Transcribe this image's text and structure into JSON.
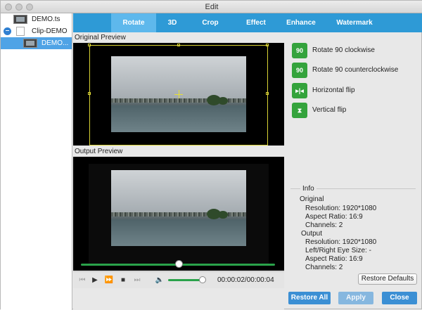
{
  "window": {
    "title": "Edit"
  },
  "sidebar": {
    "items": [
      {
        "label": "DEMO.ts"
      },
      {
        "label": "Clip-DEMO",
        "collapse_symbol": "–"
      },
      {
        "label": "DEMO..."
      }
    ]
  },
  "tabs": [
    {
      "label": "Rotate",
      "active": true
    },
    {
      "label": "3D"
    },
    {
      "label": "Crop"
    },
    {
      "label": "Effect"
    },
    {
      "label": "Enhance"
    },
    {
      "label": "Watermark"
    }
  ],
  "preview": {
    "original_label": "Original Preview",
    "output_label": "Output Preview"
  },
  "player": {
    "timecode": "00:00:02/00:00:04",
    "progress": 0.5,
    "volume": 1.0,
    "icons": [
      "skip-back-icon",
      "play-icon",
      "fast-forward-icon",
      "stop-icon",
      "skip-forward-icon",
      "volume-icon"
    ]
  },
  "actions": [
    {
      "label": "Rotate 90 clockwise",
      "icon": "rotate-clockwise-icon",
      "glyph": "90"
    },
    {
      "label": "Rotate 90 counterclockwise",
      "icon": "rotate-counterclockwise-icon",
      "glyph": "90"
    },
    {
      "label": "Horizontal flip",
      "icon": "horizontal-flip-icon",
      "glyph": "▸|◂"
    },
    {
      "label": "Vertical flip",
      "icon": "vertical-flip-icon",
      "glyph": "⧗"
    }
  ],
  "info": {
    "title": "Info",
    "original_heading": "Original",
    "original": {
      "resolution": "Resolution: 1920*1080",
      "aspect_ratio": "Aspect Ratio: 16:9",
      "channels": "Channels: 2"
    },
    "output_heading": "Output",
    "output": {
      "resolution": "Resolution: 1920*1080",
      "eye_size": "Left/Right Eye Size: -",
      "aspect_ratio": "Aspect Ratio: 16:9",
      "channels": "Channels: 2"
    }
  },
  "buttons": {
    "restore_defaults": "Restore Defaults",
    "restore_all": "Restore All",
    "apply": "Apply",
    "close": "Close"
  },
  "colors": {
    "tab_bar": "#2e9ad6",
    "tab_active": "#5eb8ec",
    "action_green": "#34a33c",
    "selection_blue": "#4fa3e6",
    "button_blue": "#3b8fd4"
  }
}
